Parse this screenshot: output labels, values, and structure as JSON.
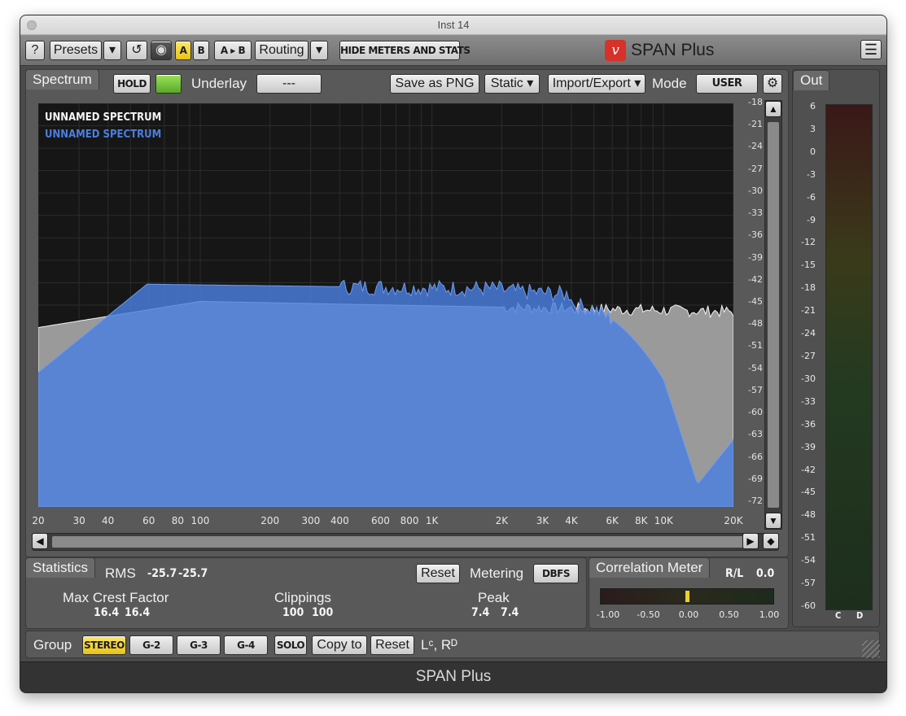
{
  "window": {
    "title": "Inst 14"
  },
  "toolbar": {
    "help": "?",
    "presets": "Presets",
    "presets_arrow": "▾",
    "undo": "↺",
    "power": "◉",
    "a": "A",
    "b": "B",
    "a_to_b": "A ▸ B",
    "routing": "Routing",
    "routing_arrow": "▾",
    "hide_meters": "HIDE METERS AND STATS",
    "brand": "SPAN Plus",
    "menu": "☰"
  },
  "spectrum": {
    "tab": "Spectrum",
    "hold": "HOLD",
    "underlay_label": "Underlay",
    "underlay_value": "---",
    "save_png": "Save as PNG",
    "static": "Static ▾",
    "import_export": "Import/Export ▾",
    "mode_label": "Mode",
    "mode_value": "USER",
    "legend": [
      {
        "label": "UNNAMED SPECTRUM",
        "color": "#ffffff"
      },
      {
        "label": "UNNAMED SPECTRUM",
        "color": "#4a7fe0"
      }
    ],
    "y_ticks": [
      "-18",
      "-21",
      "-24",
      "-27",
      "-30",
      "-33",
      "-36",
      "-39",
      "-42",
      "-45",
      "-48",
      "-51",
      "-54",
      "-57",
      "-60",
      "-63",
      "-66",
      "-69",
      "-72"
    ],
    "x_ticks": [
      "20",
      "30",
      "40",
      "60",
      "80",
      "100",
      "200",
      "300",
      "400",
      "600",
      "800",
      "1K",
      "2K",
      "3K",
      "4K",
      "6K",
      "8K",
      "10K",
      "20K"
    ]
  },
  "out": {
    "tab": "Out",
    "ticks": [
      "6",
      "3",
      "0",
      "-3",
      "-6",
      "-9",
      "-12",
      "-15",
      "-18",
      "-21",
      "-24",
      "-27",
      "-30",
      "-33",
      "-36",
      "-39",
      "-42",
      "-45",
      "-48",
      "-51",
      "-54",
      "-57",
      "-60"
    ],
    "channels": [
      "C",
      "D"
    ]
  },
  "statistics": {
    "tab": "Statistics",
    "rms_label": "RMS",
    "rms_l": "-25.7",
    "rms_r": "-25.7",
    "reset": "Reset",
    "metering_label": "Metering",
    "metering_value": "DBFS",
    "crest_label": "Max Crest Factor",
    "crest_l": "16.4",
    "crest_r": "16.4",
    "clippings_label": "Clippings",
    "clip_l": "100",
    "clip_r": "100",
    "peak_label": "Peak",
    "peak_l": "7.4",
    "peak_r": "7.4"
  },
  "correlation": {
    "tab": "Correlation Meter",
    "rl_label": "R/L",
    "rl_value": "0.0",
    "ticks": [
      "-1.00",
      "-0.50",
      "0.00",
      "0.50",
      "1.00"
    ],
    "level": 0.0
  },
  "group": {
    "label": "Group",
    "stereo": "STEREO",
    "g2": "G-2",
    "g3": "G-3",
    "g4": "G-4",
    "solo": "SOLO",
    "copy_to": "Copy to",
    "reset": "Reset",
    "routing_text": "Lᶜ, Rᴰ"
  },
  "footer": {
    "title": "SPAN Plus"
  },
  "colors": {
    "accent_yellow": "#f0cf2c",
    "spectrum_blue": "#4a7fe0",
    "underlay_gray": "#9a9a9a"
  }
}
